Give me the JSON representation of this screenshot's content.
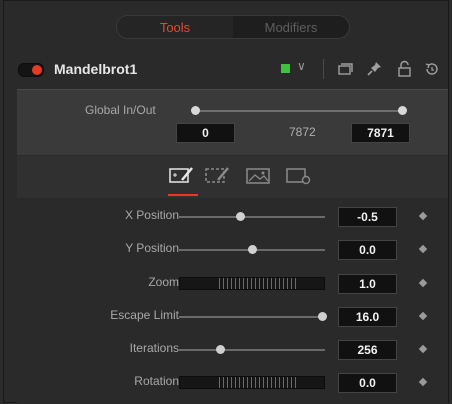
{
  "tabs": [
    {
      "label": "Tools",
      "active": true
    },
    {
      "label": "Modifiers",
      "active": false
    }
  ],
  "tool": {
    "name": "Mandelbrot1",
    "enabled": true,
    "color_chip": "#3cc43a",
    "header_icons": [
      "version-icon",
      "pin-icon",
      "lock-icon",
      "reset-icon"
    ]
  },
  "global_in_out": {
    "label": "Global In/Out",
    "in_value": "0",
    "range_value": "7872",
    "out_value": "7871"
  },
  "control_tabs": [
    {
      "icon": "controls-tab-icon",
      "active": true
    },
    {
      "icon": "color-tab-icon",
      "active": false
    },
    {
      "icon": "image-tab-icon",
      "active": false
    },
    {
      "icon": "settings-tab-icon",
      "active": false
    }
  ],
  "controls": [
    {
      "label": "X Position",
      "value": "-0.5",
      "type": "slider",
      "level": 0.42
    },
    {
      "label": "Y Position",
      "value": "0.0",
      "type": "slider",
      "level": 0.5
    },
    {
      "label": "Zoom",
      "value": "1.0",
      "type": "thumbwheel"
    },
    {
      "label": "Escape Limit",
      "value": "16.0",
      "type": "slider",
      "level": 0.98
    },
    {
      "label": "Iterations",
      "value": "256",
      "type": "slider",
      "level": 0.28
    },
    {
      "label": "Rotation",
      "value": "0.0",
      "type": "thumbwheel"
    }
  ],
  "colors": {
    "accent": "#e53a24",
    "active_tab": "#e44b2e"
  }
}
